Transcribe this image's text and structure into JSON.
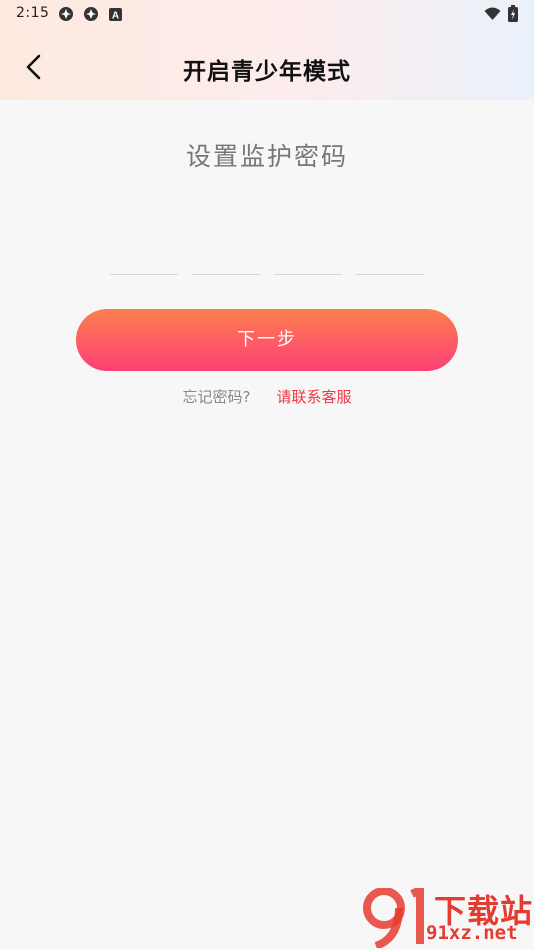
{
  "status_bar": {
    "time": "2:15",
    "icons": [
      "app-notification-icon",
      "app-notification-icon",
      "a-square-icon",
      "wifi-icon",
      "battery-icon"
    ]
  },
  "header": {
    "title": "开启青少年模式",
    "back_icon": "chevron-left-icon"
  },
  "main": {
    "heading": "设置监护密码",
    "pin_length": 4,
    "next_button": "下一步",
    "forgot_text": "忘记密码?",
    "contact_link": "请联系客服"
  },
  "watermark": {
    "brand": "下载站",
    "url": "91xz.net",
    "logo": "91-logo"
  },
  "colors": {
    "accent_gradient_start": "#fd7f4d",
    "accent_gradient_end": "#fb3f75",
    "link": "#ee3a47",
    "background": "#f7f7f7"
  }
}
